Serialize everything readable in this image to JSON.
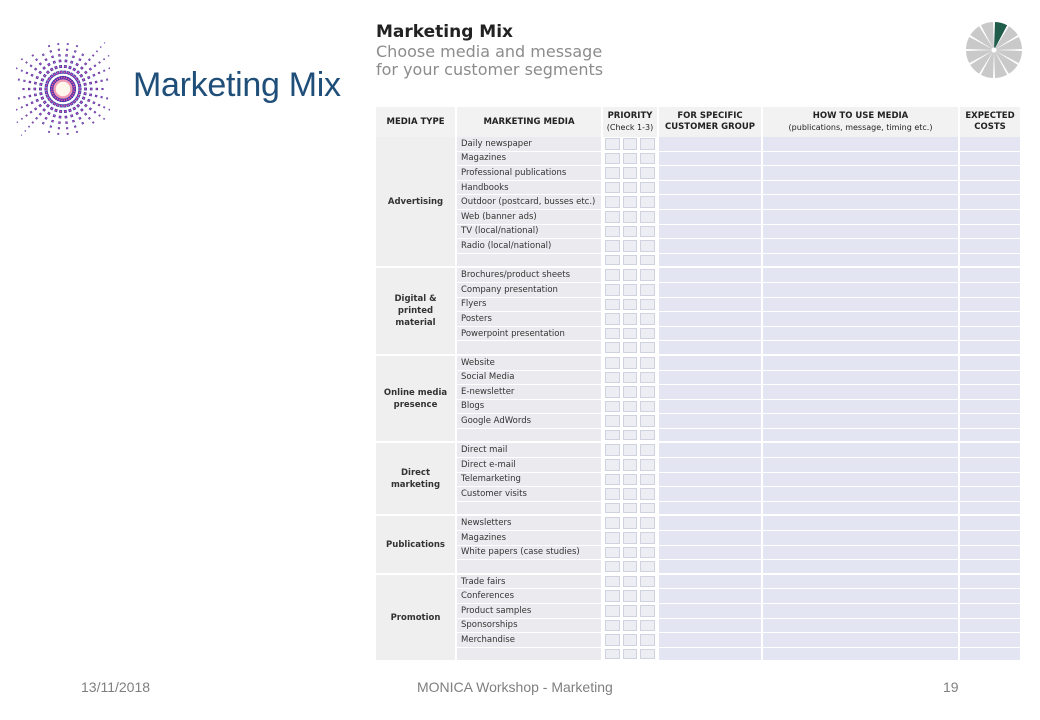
{
  "slide": {
    "title": "Marketing Mix",
    "logo_icon": "radial-logo-icon"
  },
  "worksheet": {
    "title": "Marketing Mix",
    "subtitle_line1": "Choose media and message",
    "subtitle_line2": "for your customer segments",
    "progress_icon": "progress-pie-icon"
  },
  "table": {
    "headers": {
      "media_type": "MEDIA TYPE",
      "marketing_media": "MARKETING MEDIA",
      "priority": "PRIORITY",
      "priority_sub": "(Check 1-3)",
      "customer_group_line1": "FOR SPECIFIC",
      "customer_group_line2": "CUSTOMER GROUP",
      "how_to_use": "HOW TO USE MEDIA",
      "how_to_use_sub": "(publications, message, timing etc.)",
      "expected_costs_line1": "EXPECTED",
      "expected_costs_line2": "COSTS"
    },
    "groups": [
      {
        "category": [
          "Advertising"
        ],
        "items": [
          "Daily newspaper",
          "Magazines",
          "Professional publications",
          "Handbooks",
          "Outdoor (postcard, busses etc.)",
          "Web (banner ads)",
          "TV (local/national)",
          "Radio (local/national)",
          ""
        ]
      },
      {
        "category": [
          "Digital & printed",
          "material"
        ],
        "items": [
          "Brochures/product sheets",
          "Company presentation",
          "Flyers",
          "Posters",
          "Powerpoint presentation",
          ""
        ]
      },
      {
        "category": [
          "Online media",
          "presence"
        ],
        "items": [
          "Website",
          "Social Media",
          "E-newsletter",
          "Blogs",
          "Google AdWords",
          ""
        ]
      },
      {
        "category": [
          "Direct",
          "marketing"
        ],
        "items": [
          "Direct mail",
          "Direct e-mail",
          "Telemarketing",
          "Customer visits",
          ""
        ]
      },
      {
        "category": [
          "Publications"
        ],
        "items": [
          "Newsletters",
          "Magazines",
          "White papers (case studies)",
          ""
        ]
      },
      {
        "category": [
          "Promotion"
        ],
        "items": [
          "Trade fairs",
          "Conferences",
          "Product samples",
          "Sponsorships",
          "Merchandise",
          ""
        ]
      }
    ]
  },
  "footer": {
    "date": "13/11/2018",
    "center": "MONICA Workshop  - Marketing",
    "page_number": "19"
  },
  "colors": {
    "title_blue": "#1f4e79",
    "cell_fill": "#e3e5f2",
    "category_fill": "#efefef",
    "footer_gray": "#7f7f7f"
  }
}
